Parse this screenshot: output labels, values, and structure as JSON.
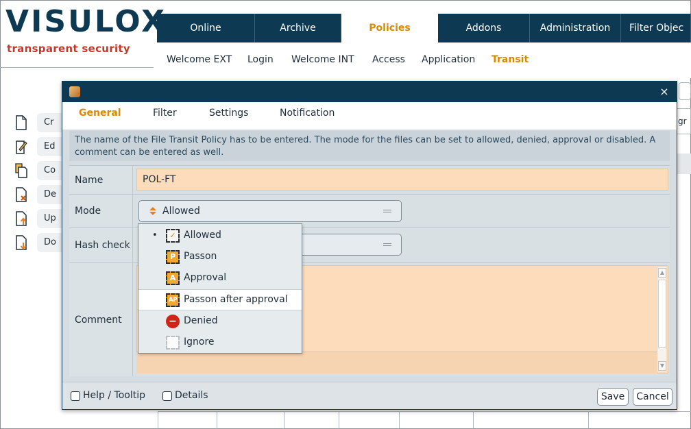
{
  "logo": {
    "title": "VISULOX",
    "subtitle": "transparent security"
  },
  "main_tabs": [
    "Online",
    "Archive",
    "Policies",
    "Addons",
    "Administration",
    "Filter Objec"
  ],
  "active_main_tab": "Policies",
  "sub_tabs": [
    "Welcome EXT",
    "Login",
    "Welcome INT",
    "Access",
    "Application",
    "Transit"
  ],
  "active_sub_tab": "Transit",
  "sidebar": [
    "Cr",
    "Ed",
    "Co",
    "De",
    "Up",
    "Do"
  ],
  "bg_right_text": "gr",
  "dialog": {
    "close": "×",
    "tabs": [
      "General",
      "Filter",
      "Settings",
      "Notification"
    ],
    "active_tab": "General",
    "description": "The name of the File Transit Policy has to be entered. The mode for the files can be set to allowed, denied, approval or disabled. A comment can be entered as well.",
    "fields": {
      "name_label": "Name",
      "name_value": "POL-FT",
      "mode_label": "Mode",
      "mode_value": "Allowed",
      "hash_label": "Hash check",
      "comment_label": "Comment"
    },
    "mode_options": [
      {
        "label": "Allowed",
        "icon": "allowed-check-icon",
        "glyph": "✓",
        "selected": true
      },
      {
        "label": "Passon",
        "icon": "passon-p-icon",
        "glyph": "P",
        "selected": false
      },
      {
        "label": "Approval",
        "icon": "approval-a-icon",
        "glyph": "A",
        "selected": false
      },
      {
        "label": "Passon after approval",
        "icon": "passon-after-approval-ap-icon",
        "glyph": "AP",
        "selected": false,
        "hover": true
      },
      {
        "label": "Denied",
        "icon": "denied-icon",
        "glyph": "−",
        "selected": false
      },
      {
        "label": "Ignore",
        "icon": "ignore-icon",
        "glyph": "",
        "selected": false
      }
    ],
    "footer": {
      "help_tooltip": "Help / Tooltip",
      "details": "Details",
      "save": "Save",
      "cancel": "Cancel"
    }
  },
  "colors": {
    "navy": "#0d3a52",
    "accent_orange": "#d98a00",
    "logo_red": "#c0392b",
    "input_peach": "#fcdcba"
  }
}
